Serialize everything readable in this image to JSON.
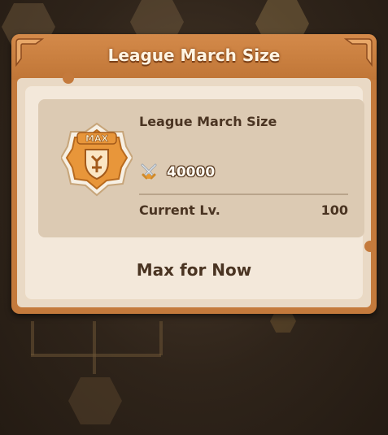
{
  "popup": {
    "title": "League March Size",
    "info": {
      "name": "League March Size",
      "badge_text": "MAX",
      "badge_icon": "march-size-badge-icon",
      "size_icon": "crossed-swords-icon",
      "size_value": "40000",
      "level_label": "Current Lv.",
      "level_value": "100"
    },
    "status_text": "Max for Now"
  },
  "colors": {
    "frame": "#c47a3c",
    "body": "#f3e8da",
    "card": "#dccab3",
    "text": "#4a3422",
    "title_text": "#fff4e3"
  }
}
